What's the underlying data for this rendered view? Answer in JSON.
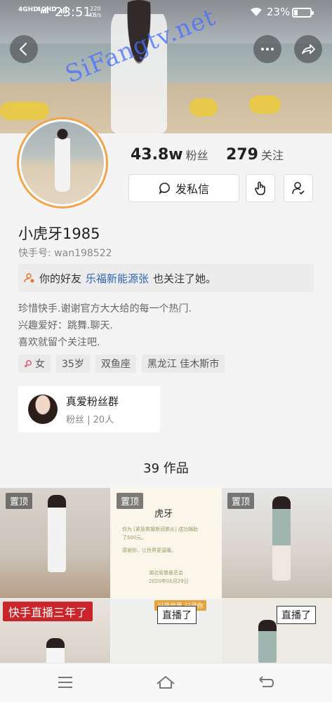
{
  "status_bar": {
    "signal_1": "4GHD",
    "signal_2": "4GHD",
    "time": "23:51",
    "net_speed_value": "220",
    "net_speed_unit": "KB/s",
    "battery_text": "23%",
    "battery_level": 0.23
  },
  "header": {
    "watermark": "SiFangtv.net",
    "back_icon": "chevron-left-icon",
    "more_icon": "more-dots-icon",
    "share_icon": "share-arrow-icon"
  },
  "profile": {
    "followers_count": "43.8w",
    "followers_label": "粉丝",
    "following_count": "279",
    "following_label": "关注",
    "message_button": "发私信",
    "username": "小虎牙1985",
    "kuaishou_id": "快手号: wan198522",
    "friend_prefix": "你的好友",
    "friend_name": "乐福新能源张",
    "friend_suffix": "也关注了她。",
    "bio_lines": [
      "珍惜快手.谢谢官方大大给的每一个热门.",
      "兴趣爱好：跳舞.聊天.",
      "喜欢就留个关注吧."
    ],
    "tags": [
      "女",
      "35岁",
      "双鱼座",
      "黑龙江 佳木斯市"
    ]
  },
  "fan_group": {
    "title": "真爱粉丝群",
    "subtitle": "粉丝 | 20人"
  },
  "works": {
    "count_label": "39 作品",
    "pinned_label": "置顶",
    "live_label": "直播了",
    "banner_text": "快手直播三年了",
    "cert_title": "虎牙",
    "cert_lines": [
      "你为 [紧急救援新冠肺炎] 成功捐助",
      "了500元。",
      "感谢你，让世界更温暖。",
      "湖北省慈善总会",
      "2020年01月29日"
    ],
    "stamp_label": "记录世界 记录你"
  },
  "bottom_nav": {
    "menu_icon": "menu-icon",
    "home_icon": "home-icon",
    "back_icon": "back-icon"
  },
  "colors": {
    "avatar_ring": "#f5a34a",
    "friend_link": "#2f65b5",
    "watermark": "#466eff",
    "banner_red": "#c9252a"
  }
}
